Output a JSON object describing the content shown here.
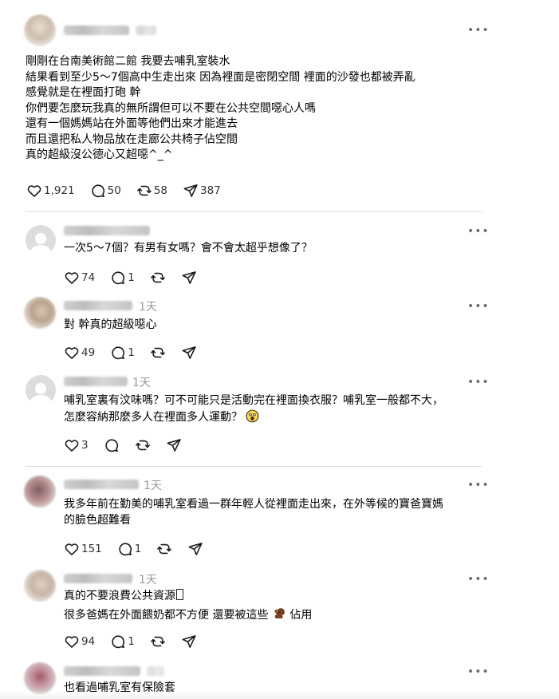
{
  "main_post": {
    "lines": [
      "剛剛在台南美術館二館 我要去哺乳室裝水",
      "結果看到至少5～7個高中生走出來 因為裡面是密閉空間 裡面的沙發也都被弄亂",
      "感覺就是在裡面打砲 幹",
      "你們要怎麼玩我真的無所謂但可以不要在公共空間噁心人嗎",
      "還有一個媽媽站在外面等他們出來才能進去",
      "而且還把私人物品放在走廊公共椅子佔空間",
      "真的超級沒公德心又超噁^_^"
    ],
    "likes": "1,921",
    "replies": "50",
    "reposts": "58",
    "shares": "387"
  },
  "comments": [
    {
      "time": "",
      "lines": [
        "一次5～7個？有男有女嗎？會不會太超乎想像了？"
      ],
      "likes": "74",
      "replies": "1"
    },
    {
      "time": "1天",
      "lines": [
        "對 幹真的超級噁心"
      ],
      "likes": "49",
      "replies": "1"
    },
    {
      "time": "1天",
      "lines": [
        "哺乳室裏有汶味嗎？可不可能只是活動完在裡面換衣服？哺乳室一般都不大，",
        "怎麼容納那麼多人在裡面多人運動？"
      ],
      "likes": "3",
      "replies": ""
    },
    {
      "time": "1天",
      "lines": [
        "我多年前在勤美的哺乳室看過一群年輕人從裡面走出來，在外等候的寶爸寶媽",
        "的臉色超難看"
      ],
      "likes": "151",
      "replies": "1"
    },
    {
      "time": "1天",
      "lines": [
        "真的不要浪費公共資源",
        "很多爸媽在外面餵奶都不方便 還要被這些",
        "佔用"
      ],
      "likes": "94",
      "replies": "1"
    },
    {
      "time": "",
      "lines": [
        "也看過哺乳室有保險套"
      ],
      "likes": "",
      "replies": ""
    }
  ],
  "more_label": "•••",
  "icons": {
    "like": "heart-icon",
    "reply": "comment-icon",
    "repost": "repost-icon",
    "share": "share-icon",
    "emoji_shocked": "shocked-face-emoji",
    "emoji_squirrel": "squirrel-emoji",
    "missing_glyph": "tofu-box-glyph"
  }
}
